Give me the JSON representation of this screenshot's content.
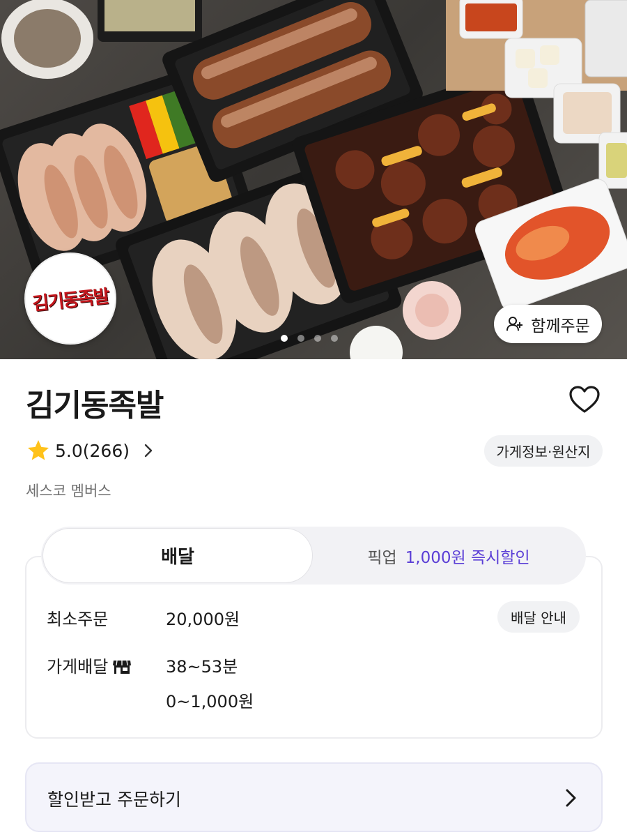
{
  "hero": {
    "group_order_label": "함께주문",
    "group_order_icon": "person-add-icon",
    "logo_text": "김기동족발",
    "slide_count": 4,
    "active_slide": 1
  },
  "store": {
    "name": "김기동족발",
    "rating_text": "5.0(266)",
    "info_button": "가게정보·원산지",
    "member_label": "세스코 멤버스",
    "favorite_icon": "heart-outline-icon"
  },
  "order_type_tabs": {
    "delivery": "배달",
    "pickup": "픽업",
    "pickup_promo": "1,000원 즉시할인"
  },
  "delivery_info": {
    "min_order_label": "최소주문",
    "min_order_value": "20,000원",
    "guide_button": "배달 안내",
    "store_delivery_label": "가게배달",
    "store_delivery_icon": "storefront-icon",
    "delivery_time": "38~53분",
    "delivery_fee": "0~1,000원"
  },
  "discount_order": {
    "label": "할인받고 주문하기"
  },
  "colors": {
    "accent_purple": "#5b3fd6",
    "star_yellow": "#ffc21a",
    "logo_red": "#c4161c"
  }
}
